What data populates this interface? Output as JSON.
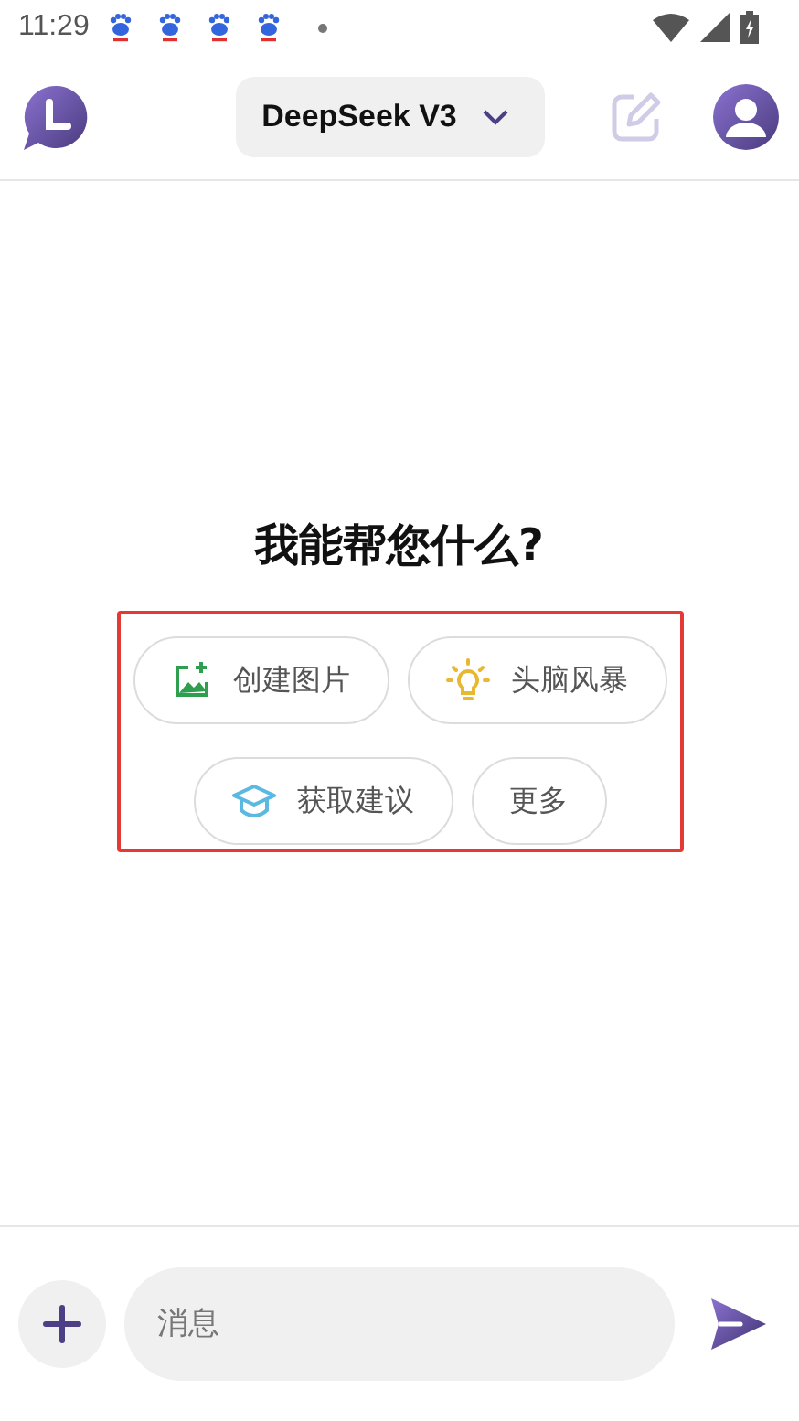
{
  "status_bar": {
    "time": "11:29",
    "notifications": [
      {
        "kind": "paw"
      },
      {
        "kind": "paw"
      },
      {
        "kind": "paw"
      },
      {
        "kind": "paw"
      }
    ]
  },
  "header": {
    "model": "DeepSeek V3"
  },
  "prompt": {
    "title": "我能帮您什么?"
  },
  "suggestions": [
    {
      "label": "创建图片",
      "kind": "image"
    },
    {
      "label": "头脑风暴",
      "kind": "bulb"
    },
    {
      "label": "获取建议",
      "kind": "cap"
    },
    {
      "label": "更多",
      "kind": "plain"
    }
  ],
  "composer": {
    "placeholder": "消息"
  }
}
